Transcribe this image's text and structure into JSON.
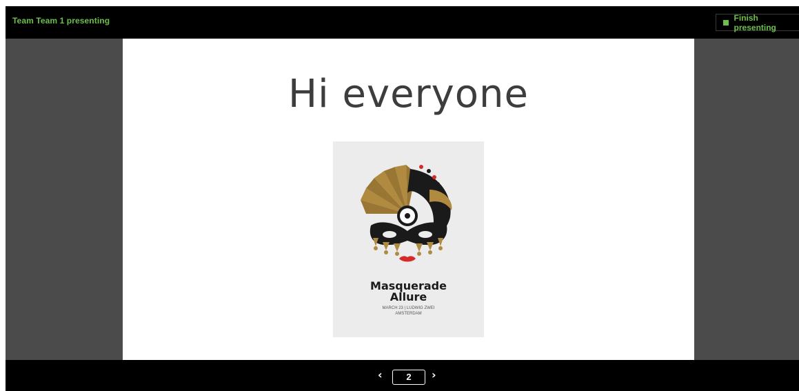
{
  "topbar": {
    "presenting_label": "Team Team 1 presenting",
    "finish_button_label": "Finish presenting",
    "accent_color": "#6cc04a"
  },
  "slide": {
    "title": "Hi everyone",
    "poster": {
      "title_line1": "Masquerade",
      "title_line2": "Allure",
      "subtitle_line1": "MARCH 23 | LUDWIG ZWEI",
      "subtitle_line2": "AMSTERDAM"
    }
  },
  "pagination": {
    "current_page": "2",
    "prev_icon": "chevron-left-icon",
    "next_icon": "chevron-right-icon"
  }
}
